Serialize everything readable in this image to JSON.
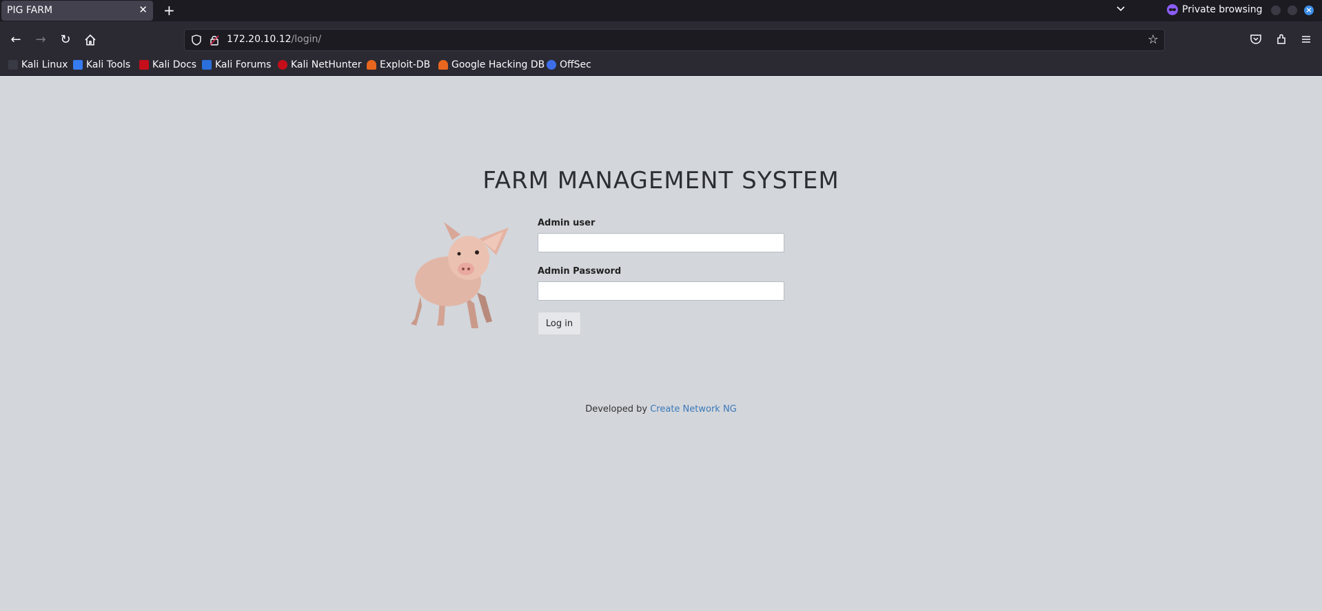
{
  "browser": {
    "tab_title": "PIG FARM",
    "tab_close": "✕",
    "new_tab": "+",
    "private_label": "Private browsing",
    "url_host": "172.20.10.12",
    "url_path": "/login/",
    "bookmarks": [
      {
        "label": "Kali Linux",
        "color": "#1c1b22"
      },
      {
        "label": "Kali Tools",
        "color": "#367bf0"
      },
      {
        "label": "Kali Docs",
        "color": "#c40f1a"
      },
      {
        "label": "Kali Forums",
        "color": "#2a6fdb"
      },
      {
        "label": "Kali NetHunter",
        "color": "#c40f1a"
      },
      {
        "label": "Exploit-DB",
        "color": "#e8661e"
      },
      {
        "label": "Google Hacking DB",
        "color": "#e8661e"
      },
      {
        "label": "OffSec",
        "color": "#3d6ee8"
      }
    ]
  },
  "page": {
    "title": "FARM MANAGEMENT SYSTEM",
    "user_label": "Admin user",
    "user_value": "",
    "password_label": "Admin Password",
    "password_value": "",
    "login_button": "Log in",
    "footer_prefix": "Developed by",
    "footer_link": "Create Network NG"
  },
  "colors": {
    "page_bg": "#d3d6db",
    "link": "#3b79b8",
    "chrome_dark": "#1c1b22",
    "chrome_toolbar": "#2b2a33"
  }
}
